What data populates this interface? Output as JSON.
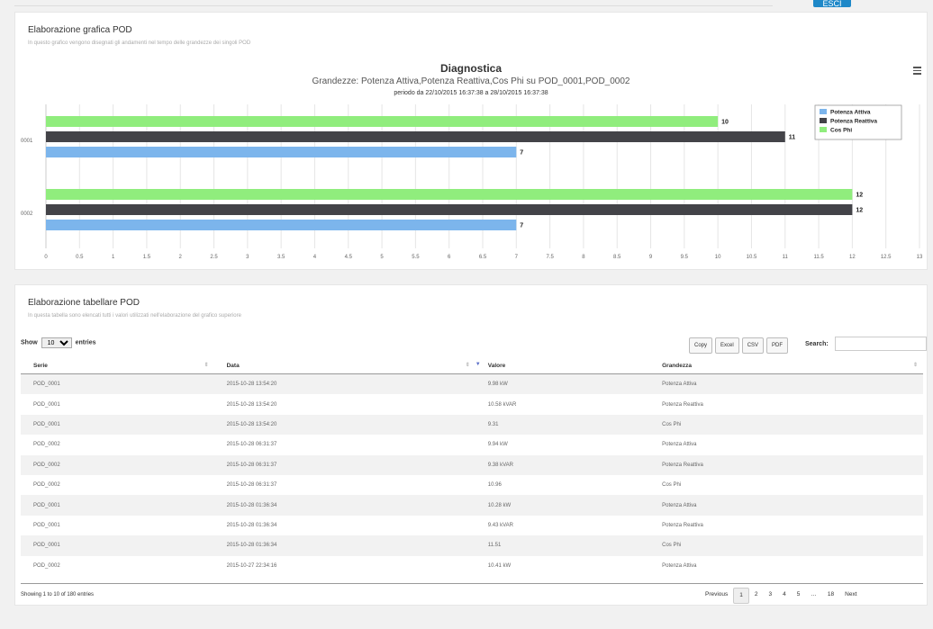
{
  "header": {
    "exit_label": "ESCI"
  },
  "chart_panel": {
    "title": "Elaborazione grafica POD",
    "subtitle": "In questo grafico vengono disegnati gli andamenti nel tempo delle grandezze dei singoli POD"
  },
  "chart_data": {
    "type": "bar",
    "orientation": "horizontal",
    "title": "Diagnostica",
    "subtitle": "Grandezze: Potenza Attiva,Potenza Reattiva,Cos Phi su POD_0001,POD_0002",
    "period": "periodo da 22/10/2015 16:37:38 a 28/10/2015 16:37:38",
    "categories": [
      "0001",
      "0002"
    ],
    "series": [
      {
        "name": "Potenza Attiva",
        "color": "#7cb5ec",
        "values": [
          7,
          7
        ]
      },
      {
        "name": "Potenza Reattiva",
        "color": "#434348",
        "values": [
          11,
          12
        ]
      },
      {
        "name": "Cos Phi",
        "color": "#90ed7d",
        "values": [
          10,
          12
        ]
      }
    ],
    "xlim": [
      0,
      13
    ],
    "ticks": [
      "0",
      "0.5",
      "1",
      "1.5",
      "2",
      "2.5",
      "3",
      "3.5",
      "4",
      "4.5",
      "5",
      "5.5",
      "6",
      "6.5",
      "7",
      "7.5",
      "8",
      "8.5",
      "9",
      "9.5",
      "10",
      "10.5",
      "11",
      "11.5",
      "12",
      "12.5",
      "13"
    ],
    "grid": true,
    "legend_position": "top-right"
  },
  "table_panel": {
    "title": "Elaborazione tabellare POD",
    "subtitle": "In questa tabella sono elencati tutti i valori utilizzati nell'elaborazione del grafico superiore",
    "show_label": "Show",
    "entries_value": "10",
    "entries_label": "entries",
    "buttons": [
      "Copy",
      "Excel",
      "CSV",
      "PDF"
    ],
    "search_label": "Search:",
    "search_value": "",
    "columns": [
      "Serie",
      "Data",
      "Valore",
      "Grandezza"
    ],
    "rows": [
      [
        "POD_0001",
        "2015-10-28 13:54:20",
        "9.98 kW",
        "Potenza Attiva"
      ],
      [
        "POD_0001",
        "2015-10-28 13:54:20",
        "10.58 kVAR",
        "Potenza Reattiva"
      ],
      [
        "POD_0001",
        "2015-10-28 13:54:20",
        "9.31",
        "Cos Phi"
      ],
      [
        "POD_0002",
        "2015-10-28 06:31:37",
        "9.94 kW",
        "Potenza Attiva"
      ],
      [
        "POD_0002",
        "2015-10-28 06:31:37",
        "9.38 kVAR",
        "Potenza Reattiva"
      ],
      [
        "POD_0002",
        "2015-10-28 06:31:37",
        "10.96",
        "Cos Phi"
      ],
      [
        "POD_0001",
        "2015-10-28 01:36:34",
        "10.28 kW",
        "Potenza Attiva"
      ],
      [
        "POD_0001",
        "2015-10-28 01:36:34",
        "9.43 kVAR",
        "Potenza Reattiva"
      ],
      [
        "POD_0001",
        "2015-10-28 01:36:34",
        "11.51",
        "Cos Phi"
      ],
      [
        "POD_0002",
        "2015-10-27 22:34:16",
        "10.41 kW",
        "Potenza Attiva"
      ]
    ],
    "info": "Showing 1 to 10 of 180 entries",
    "pagination": {
      "previous": "Previous",
      "pages": [
        "1",
        "2",
        "3",
        "4",
        "5",
        "…",
        "18"
      ],
      "active": "1",
      "next": "Next"
    }
  }
}
